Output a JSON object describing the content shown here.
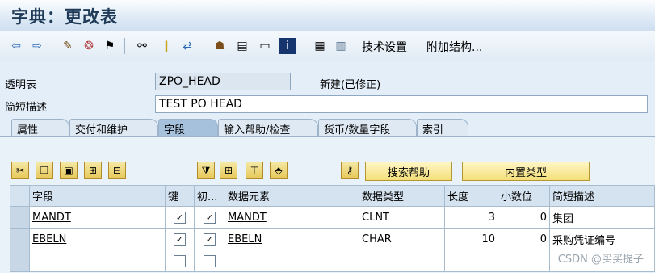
{
  "window": {
    "title": "字典：更改表"
  },
  "toolbar": {
    "icons": [
      "back-arrow",
      "forward-arrow",
      "edit-glasses",
      "other-object",
      "activate",
      "where-used",
      "test",
      "navigate",
      "hierarchy",
      "print",
      "display-text",
      "info",
      "table-layout",
      "grid"
    ],
    "technical_settings": "技术设置",
    "append_structure": "附加结构..."
  },
  "header": {
    "transparent_table_label": "透明表",
    "transparent_table_value": "ZPO_HEAD",
    "status": "新建(已修正)",
    "short_desc_label": "简短描述",
    "short_desc_value": "TEST PO HEAD"
  },
  "tabs": [
    "属性",
    "交付和维护",
    "字段",
    "输入帮助/检查",
    "货币/数量字段",
    "索引"
  ],
  "active_tab": "字段",
  "buttons": {
    "search_help": "搜索帮助",
    "builtin_type": "内置类型"
  },
  "grid": {
    "columns": [
      "字段",
      "键",
      "初...",
      "数据元素",
      "数据类型",
      "长度",
      "小数位",
      "简短描述"
    ],
    "rows": [
      {
        "field": "MANDT",
        "key": true,
        "init": true,
        "element": "MANDT",
        "type": "CLNT",
        "length": "3",
        "decimals": "0",
        "desc": "集团"
      },
      {
        "field": "EBELN",
        "key": true,
        "init": true,
        "element": "EBELN",
        "type": "CHAR",
        "length": "10",
        "decimals": "0",
        "desc": "采购凭证编号"
      },
      {
        "field": "",
        "key": false,
        "init": false,
        "element": "",
        "type": "",
        "length": "",
        "decimals": "",
        "desc": ""
      }
    ]
  },
  "watermark": "CSDN @买买提子"
}
